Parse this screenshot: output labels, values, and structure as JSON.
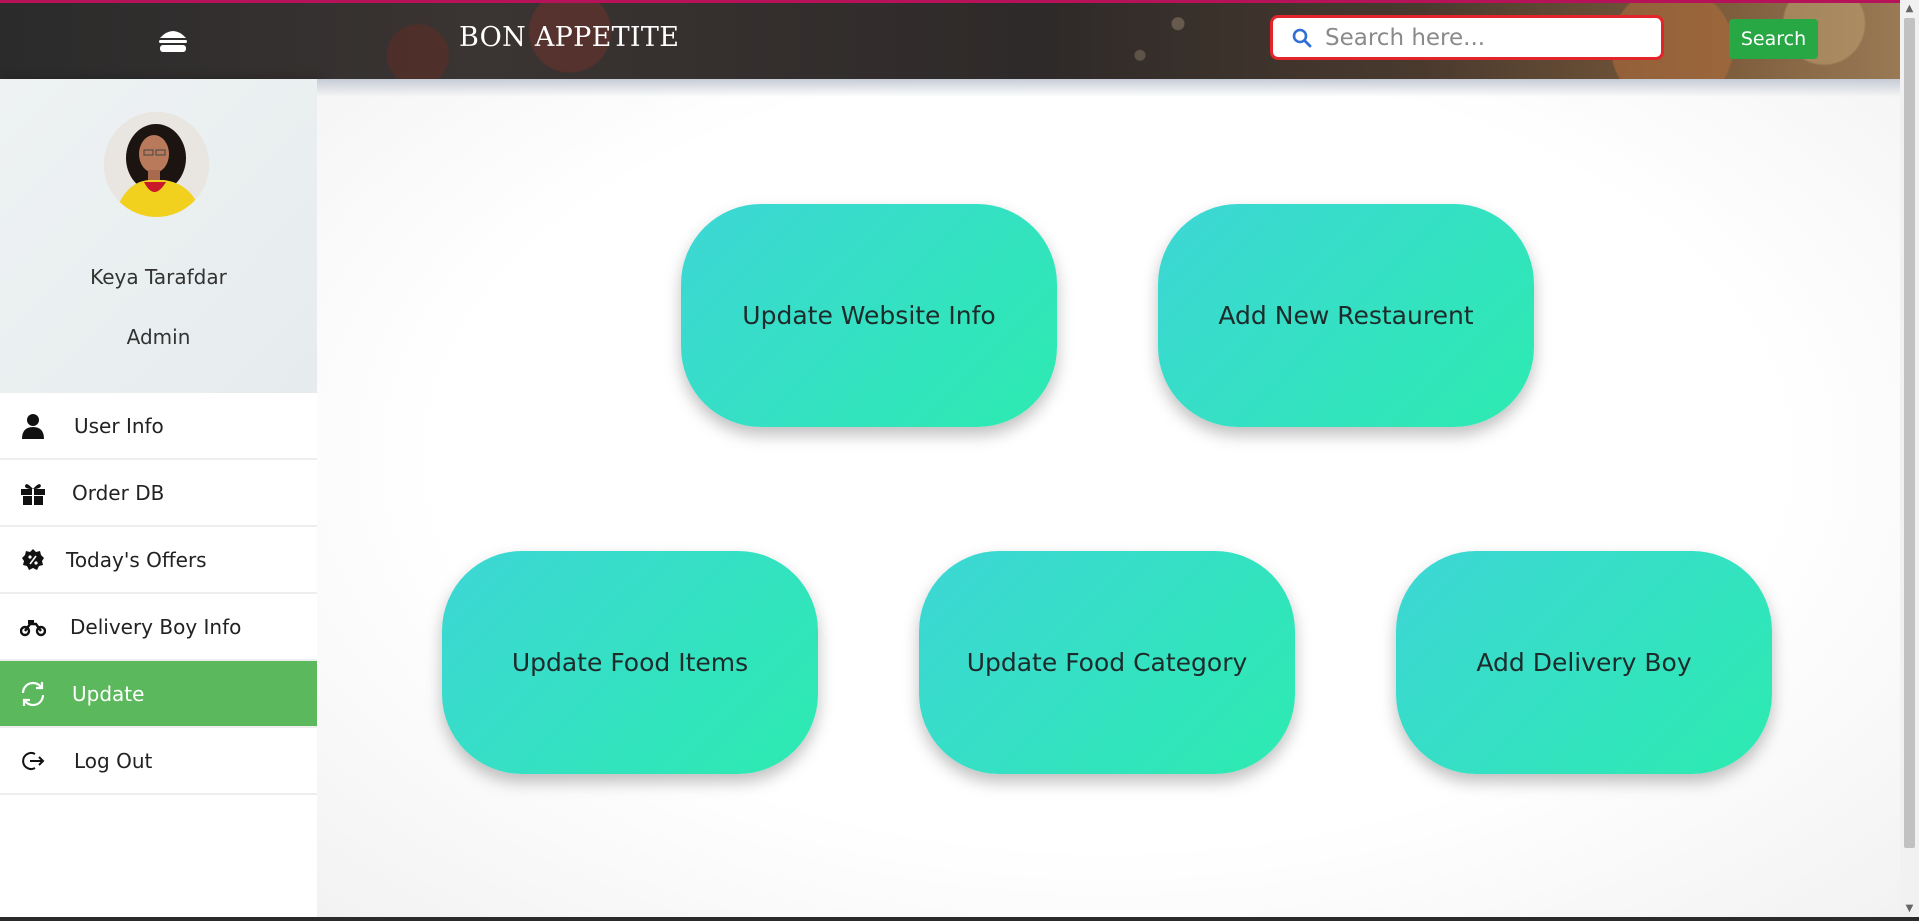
{
  "header": {
    "brand": "BON APPETITE",
    "search_placeholder": "Search here...",
    "search_button": "Search",
    "menu_icon": "burger-icon"
  },
  "profile": {
    "name": "Keya Tarafdar",
    "role": "Admin"
  },
  "sidebar": {
    "items": [
      {
        "label": "User Info",
        "icon": "user-icon",
        "active": false
      },
      {
        "label": "Order DB",
        "icon": "gift-icon",
        "active": false
      },
      {
        "label": "Today's Offers",
        "icon": "badge-percent-icon",
        "active": false
      },
      {
        "label": "Delivery Boy Info",
        "icon": "motorcycle-icon",
        "active": false
      },
      {
        "label": "Update",
        "icon": "refresh-icon",
        "active": true
      },
      {
        "label": "Log Out",
        "icon": "logout-icon",
        "active": false
      }
    ]
  },
  "tiles": [
    {
      "label": "Update Website Info"
    },
    {
      "label": "Add New Restaurent"
    },
    {
      "label": "Update Food Items"
    },
    {
      "label": "Update Food Category"
    },
    {
      "label": "Add Delivery Boy"
    }
  ],
  "colors": {
    "active_menu": "#5cb85c",
    "search_button": "#28a745",
    "search_border": "#e3242b",
    "tile_gradient_start": "#3dd6d6",
    "tile_gradient_end": "#2cebb0"
  }
}
